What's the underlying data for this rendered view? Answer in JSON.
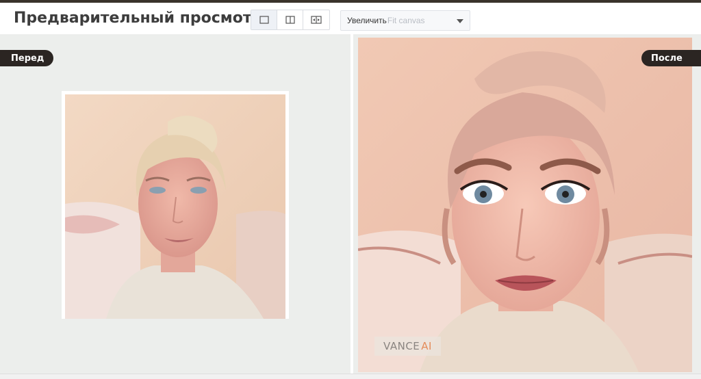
{
  "header": {
    "title": "Предварительный просмотр",
    "view_modes": [
      "single-view-icon",
      "split-view-icon",
      "slider-compare-icon"
    ],
    "zoom": {
      "label": "Увеличить",
      "value": "Fit canvas"
    }
  },
  "before": {
    "label": "Перед"
  },
  "after": {
    "label": "После",
    "watermark_main": "VANCE",
    "watermark_accent": "AI"
  },
  "colors": {
    "badge": "#2b2522",
    "pane": "#eceeec",
    "accent": "#e48b59"
  }
}
